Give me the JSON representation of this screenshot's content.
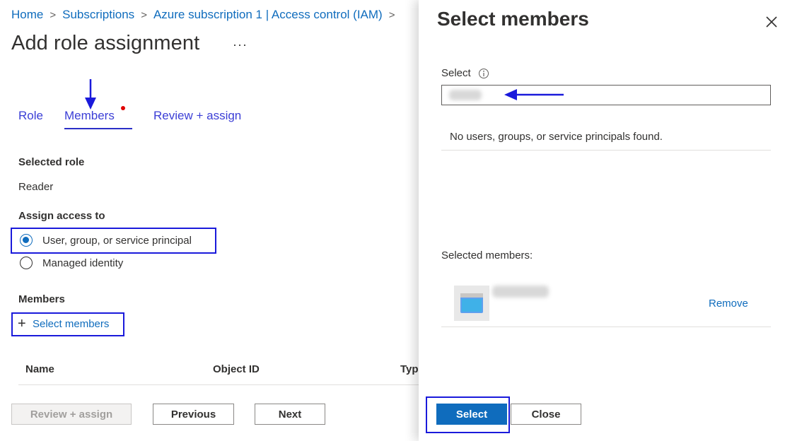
{
  "breadcrumb": {
    "items": [
      "Home",
      "Subscriptions",
      "Azure subscription 1 | Access control (IAM)"
    ],
    "separator": ">"
  },
  "page": {
    "title": "Add role assignment",
    "more": "···"
  },
  "tabs": [
    {
      "label": "Role"
    },
    {
      "label": "Members",
      "active": true,
      "required_marker": true
    },
    {
      "label": "Review + assign"
    }
  ],
  "selected_role": {
    "heading": "Selected role",
    "value": "Reader"
  },
  "assign_access": {
    "heading": "Assign access to",
    "options": [
      {
        "label": "User, group, or service principal",
        "selected": true
      },
      {
        "label": "Managed identity",
        "selected": false
      }
    ]
  },
  "members": {
    "heading": "Members",
    "select_link": "Select members",
    "plus": "+"
  },
  "table": {
    "columns": [
      "Name",
      "Object ID",
      "Typ"
    ]
  },
  "footer": {
    "review_assign": "Review + assign",
    "previous": "Previous",
    "next": "Next"
  },
  "panel": {
    "title": "Select members",
    "select_label": "Select",
    "info_icon": "info-icon",
    "no_results": "No users, groups, or service principals found.",
    "selected_members_label": "Selected members:",
    "remove": "Remove",
    "select_button": "Select",
    "close_button": "Close"
  },
  "colors": {
    "accent": "#0f6cbd",
    "annotation": "#1a1adb",
    "required": "#e00000"
  }
}
